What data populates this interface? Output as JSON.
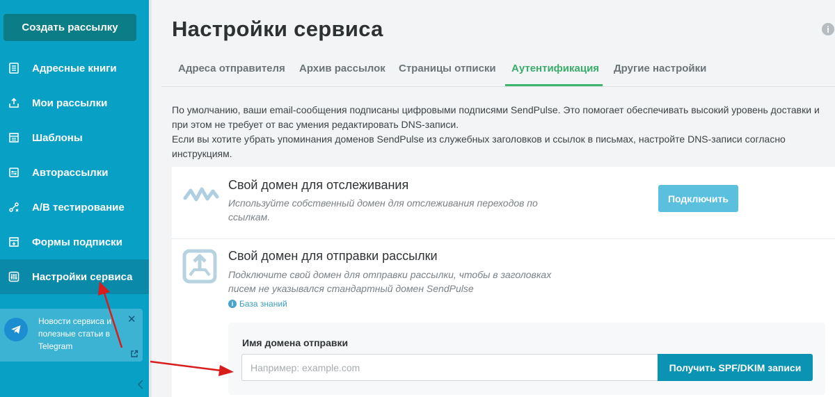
{
  "sidebar": {
    "create_label": "Создать рассылку",
    "items": [
      {
        "label": "Адресные книги",
        "icon": "address-book-icon"
      },
      {
        "label": "Мои рассылки",
        "icon": "campaigns-icon"
      },
      {
        "label": "Шаблоны",
        "icon": "templates-icon"
      },
      {
        "label": "Авторассылки",
        "icon": "automation-icon"
      },
      {
        "label": "A/B тестирование",
        "icon": "ab-test-icon"
      },
      {
        "label": "Формы подписки",
        "icon": "forms-icon"
      },
      {
        "label": "Настройки сервиса",
        "icon": "settings-sliders-icon"
      }
    ],
    "active_index": 6,
    "telegram": {
      "text": "Новости сервиса и полезные статьи в Telegram",
      "close": "✕"
    }
  },
  "page": {
    "title": "Настройки сервиса"
  },
  "tabs": [
    {
      "label": "Адреса отправителя"
    },
    {
      "label": "Архив рассылок"
    },
    {
      "label": "Страницы отписки"
    },
    {
      "label": "Аутентификация"
    },
    {
      "label": "Другие настройки"
    }
  ],
  "active_tab": 3,
  "description": {
    "line1": "По умолчанию, ваши email-сообщения подписаны цифровыми подписями SendPulse. Это помогает обеспечивать высокий уровень доставки и при этом не требует от вас умения редактировать DNS-записи.",
    "line2": "Если вы хотите убрать упоминания доменов SendPulse из служебных заголовков и ссылок в письмах, настройте DNS-записи согласно инструкциям."
  },
  "tracking": {
    "title": "Свой домен для отслеживания",
    "desc": "Используйте собственный домен для отслеживания переходов по ссылкам.",
    "button": "Подключить"
  },
  "sending": {
    "title": "Свой домен для отправки рассылки",
    "desc": "Подключите свой домен для отправки рассылки, чтобы в заголовках писем не указывался стандартный домен SendPulse",
    "kb_link": "База знаний",
    "field_label": "Имя домена отправки",
    "placeholder": "Например: example.com",
    "button": "Получить SPF/DKIM записи"
  },
  "colors": {
    "sidebar": "#08a0c5",
    "accent_green": "#3bb56e",
    "button_blue": "#0b93b3",
    "arrow_red": "#e02020"
  }
}
